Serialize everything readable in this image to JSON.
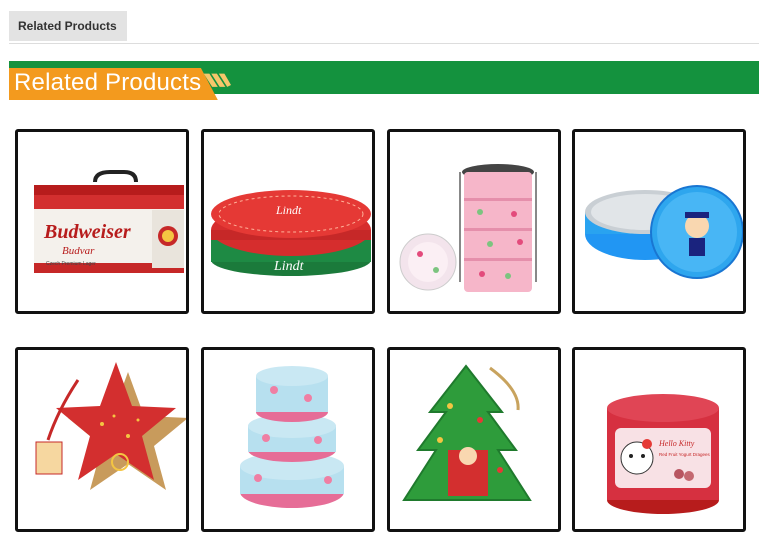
{
  "tab": {
    "label": "Related Products"
  },
  "banner": {
    "title": "Related Products"
  },
  "products": [
    {
      "name": "Budweiser lunch box tin",
      "brand_text": "Budweiser",
      "sub_text": "Budvar",
      "tag_text": "Czech Premium Lager"
    },
    {
      "name": "Lindt oval tin",
      "brand_text": "Lindt",
      "lid_text": "Lindt"
    },
    {
      "name": "Stackable pink food carrier tin"
    },
    {
      "name": "Blue round cookie tin"
    },
    {
      "name": "Red star shaped tin"
    },
    {
      "name": "Floral round nesting tins"
    },
    {
      "name": "Christmas tree shaped tin"
    },
    {
      "name": "Hello Kitty round tin",
      "brand_text": "Hello Kitty",
      "sub_text": "Red Fruit Yogurt Dragees"
    }
  ]
}
